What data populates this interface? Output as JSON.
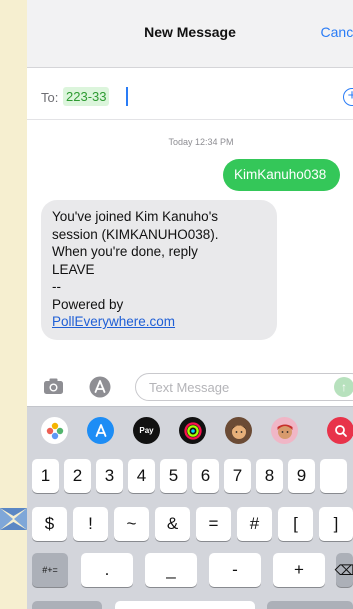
{
  "header": {
    "title": "New Message",
    "cancel_label": "Cance"
  },
  "to_row": {
    "label": "To:",
    "recipient": "223-33"
  },
  "conversation": {
    "timestamp": "Today 12:34 PM",
    "sent_message": "KimKanuho038",
    "received_lines": [
      "You've joined Kim Kanuho's",
      "session (KIMKANUHO038).",
      "When you're done, reply",
      "LEAVE",
      "--",
      "Powered by"
    ],
    "received_link": "PollEverywhere.com"
  },
  "compose": {
    "placeholder": "Text Message"
  },
  "app_strip": {
    "icons": [
      "photos-app-icon",
      "app-store-icon",
      "apple-pay-icon",
      "fitness-icon",
      "memoji-icon",
      "memoji-2-icon",
      "search-web-icon"
    ],
    "apple_pay_label": "Pay"
  },
  "keyboard": {
    "row1": [
      "1",
      "2",
      "3",
      "4",
      "5",
      "6",
      "7",
      "8",
      "9"
    ],
    "row2": [
      "$",
      "!",
      "~",
      "&",
      "=",
      "#",
      "[",
      "]"
    ],
    "row3_mode": "#+=",
    "row3": [
      ".",
      "_",
      "-",
      "+"
    ],
    "delete_glyph": "⌫"
  },
  "colors": {
    "accent": "#2a7cf6",
    "sent_bubble": "#34c759",
    "received_bubble": "#e9e9eb",
    "link": "#1f5fd6",
    "keyboard_bg": "#d3d5db",
    "page_bg": "#f6efd0"
  }
}
